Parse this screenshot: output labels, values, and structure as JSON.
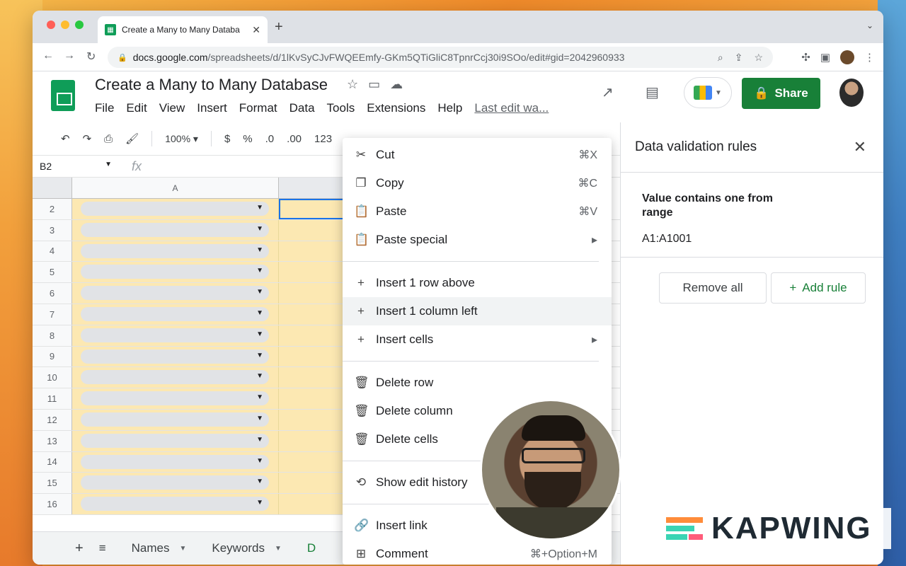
{
  "browser": {
    "tab_title": "Create a Many to Many Databa",
    "url_host": "docs.google.com",
    "url_path": "/spreadsheets/d/1lKvSyCJvFWQEEmfy-GKm5QTiGliC8TpnrCcj30i9SOo/edit#gid=2042960933"
  },
  "doc": {
    "title": "Create a Many to Many Database",
    "menu": [
      "File",
      "Edit",
      "View",
      "Insert",
      "Format",
      "Data",
      "Tools",
      "Extensions",
      "Help"
    ],
    "last_edit": "Last edit wa...",
    "share_label": "Share"
  },
  "toolbar": {
    "zoom": "100%",
    "currency": "$",
    "percent": "%",
    "dec_less": ".0",
    "dec_more": ".00",
    "num_format": "123"
  },
  "formula": {
    "name_box": "B2",
    "fx": "fx"
  },
  "grid": {
    "col_a": "A",
    "rows": [
      "2",
      "3",
      "4",
      "5",
      "6",
      "7",
      "8",
      "9",
      "10",
      "11",
      "12",
      "13",
      "14",
      "15",
      "16"
    ]
  },
  "sheets": {
    "tabs": [
      "Names",
      "Keywords",
      "D"
    ]
  },
  "context_menu": {
    "items": [
      {
        "label": "Cut",
        "shortcut": "⌘X",
        "icon": "scissors-icon"
      },
      {
        "label": "Copy",
        "shortcut": "⌘C",
        "icon": "copy-icon"
      },
      {
        "label": "Paste",
        "shortcut": "⌘V",
        "icon": "clipboard-icon"
      },
      {
        "label": "Paste special",
        "shortcut": "▸",
        "icon": "clipboard-icon"
      },
      {
        "label": "Insert 1 row above",
        "shortcut": "",
        "icon": "plus-icon"
      },
      {
        "label": "Insert 1 column left",
        "shortcut": "",
        "icon": "plus-icon"
      },
      {
        "label": "Insert cells",
        "shortcut": "▸",
        "icon": "plus-icon"
      },
      {
        "label": "Delete row",
        "shortcut": "",
        "icon": "trash-icon"
      },
      {
        "label": "Delete column",
        "shortcut": "",
        "icon": "trash-icon"
      },
      {
        "label": "Delete cells",
        "shortcut": "",
        "icon": "trash-icon"
      },
      {
        "label": "Show edit history",
        "shortcut": "",
        "icon": "history-icon"
      },
      {
        "label": "Insert link",
        "shortcut": "",
        "icon": "link-icon"
      },
      {
        "label": "Comment",
        "shortcut": "⌘+Option+M",
        "icon": "comment-plus-icon"
      }
    ]
  },
  "panel": {
    "title": "Data validation rules",
    "rule_title": "Value contains one from range",
    "rule_range": "A1:A1001",
    "remove_all": "Remove all",
    "add_rule": "Add rule"
  },
  "watermark": {
    "text": "KAPWING"
  },
  "colors": {
    "share_green": "#188038",
    "cell_yellow": "#fce8b2",
    "selection_blue": "#1a73e8"
  }
}
